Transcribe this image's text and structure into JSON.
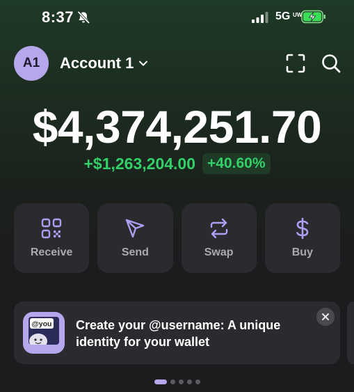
{
  "status_bar": {
    "time": "8:37",
    "network": "5G",
    "network_sub": "UW",
    "icons": [
      "bell-off-icon",
      "signal-icon",
      "battery-charging-icon"
    ]
  },
  "header": {
    "avatar_initials": "A1",
    "account_name": "Account 1",
    "icons": [
      "chevron-down-icon",
      "scan-icon",
      "search-icon"
    ]
  },
  "balance": {
    "total": "$4,374,251.70",
    "change_amount": "+$1,263,204.00",
    "change_percent": "+40.60%"
  },
  "actions": [
    {
      "label": "Receive",
      "icon": "qr-code-icon"
    },
    {
      "label": "Send",
      "icon": "send-icon"
    },
    {
      "label": "Swap",
      "icon": "swap-icon"
    },
    {
      "label": "Buy",
      "icon": "dollar-icon"
    }
  ],
  "promo": {
    "badge": "@you",
    "text": "Create your @username: A unique identity for your wallet"
  },
  "pager": {
    "count": 5,
    "active_index": 0
  },
  "colors": {
    "accent": "#b6a6ec",
    "positive": "#33d06a",
    "card": "#2b2b2f",
    "background": "#1c1c1e"
  }
}
